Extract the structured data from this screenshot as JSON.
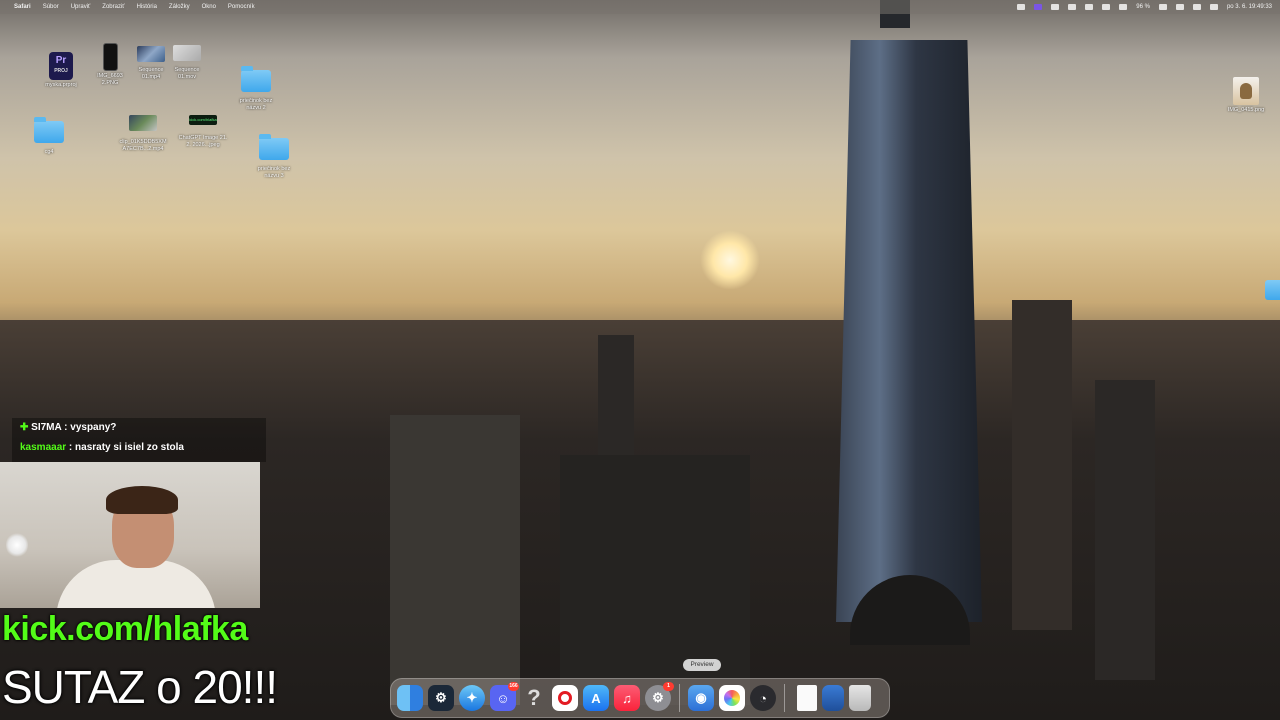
{
  "menubar": {
    "apple_glyph": "",
    "items": [
      "Safari",
      "Súbor",
      "Upraviť",
      "Zobraziť",
      "História",
      "Záložky",
      "Okno",
      "Pomocník"
    ],
    "battery": "96 %",
    "datetime": "po 3. 6.  19:49:33"
  },
  "desktop": {
    "icons": [
      {
        "name": "myska.prproj",
        "label": "myska.prproj",
        "badge": "Pr",
        "sub": "PROJ"
      },
      {
        "name": "IMG_6693",
        "label": "IMG_6693\n2.PNG"
      },
      {
        "name": "Sequence 01.mp4",
        "label": "Sequence\n01.mp4"
      },
      {
        "name": "Sequence 01.mov",
        "label": "Sequence\n01.mov"
      },
      {
        "name": "priecinok bez nazvu 2",
        "label": "priečinok bez\nnázvu 2"
      },
      {
        "name": "cg4",
        "label": "cg4"
      },
      {
        "name": "clip",
        "label": "clip_01K5DDB5XM\nA7EC7B...2.mp4"
      },
      {
        "name": "ChatGPT image",
        "label": "ChatGPT Image 21.\n2. 2026...jpeg",
        "thumb_text": "kick.com/hlafka"
      },
      {
        "name": "priecinok bez nazvu 3",
        "label": "priečinok bez\nnázvu 3"
      },
      {
        "name": "IMG_0415",
        "label": "IMG_0415.png"
      }
    ]
  },
  "chat": {
    "messages": [
      {
        "user": "SI7MA",
        "text": " : vyspany?",
        "color": "#ffffff",
        "prefix": "✚"
      },
      {
        "user": "kasmaaar",
        "text": " : nasraty si isiel zo stola",
        "color": "#53fc18",
        "prefix": ""
      }
    ]
  },
  "overlay": {
    "kick": "kick.com/hlafka",
    "sutaz": "SUTAZ o 20!!!"
  },
  "dock": {
    "tooltip": "Preview",
    "apps": [
      {
        "id": "finder",
        "icon": "finder-icon"
      },
      {
        "id": "steam",
        "icon": "steam-icon",
        "glyph": "⚙"
      },
      {
        "id": "safari",
        "icon": "safari-icon",
        "glyph": "✦"
      },
      {
        "id": "discord",
        "icon": "discord-icon",
        "glyph": "☺",
        "badge": "166"
      },
      {
        "id": "unknown",
        "icon": "question-icon",
        "glyph": "?"
      },
      {
        "id": "opera",
        "icon": "opera-icon"
      },
      {
        "id": "appstore",
        "icon": "appstore-icon",
        "glyph": "A"
      },
      {
        "id": "music",
        "icon": "music-icon",
        "glyph": "♫"
      },
      {
        "id": "settings",
        "icon": "settings-icon",
        "glyph": "⚙",
        "badge": "1"
      },
      {
        "id": "preview",
        "icon": "preview-icon",
        "glyph": "◉"
      },
      {
        "id": "photos",
        "icon": "photos-icon"
      },
      {
        "id": "speedtest",
        "icon": "speedtest-icon",
        "glyph": "◔"
      },
      {
        "id": "document",
        "icon": "document-icon"
      },
      {
        "id": "downloads",
        "icon": "downloads-folder-icon"
      },
      {
        "id": "trash",
        "icon": "trash-icon"
      }
    ]
  },
  "colors": {
    "kick_green": "#53fc18",
    "badge_red": "#ff3b30"
  }
}
